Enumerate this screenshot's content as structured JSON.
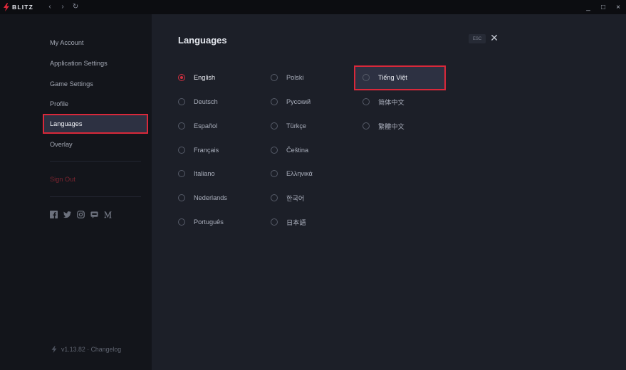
{
  "titlebar": {
    "app_name": "BLITZ",
    "back": "‹",
    "forward": "›",
    "refresh": "↻",
    "minimize": "_",
    "maximize": "□",
    "close": "×"
  },
  "sidebar": {
    "items": [
      {
        "label": "My Account"
      },
      {
        "label": "Application Settings"
      },
      {
        "label": "Game Settings"
      },
      {
        "label": "Profile"
      },
      {
        "label": "Languages",
        "active": true
      },
      {
        "label": "Overlay"
      }
    ],
    "sign_out": "Sign Out",
    "socials": [
      "facebook-icon",
      "twitter-icon",
      "instagram-icon",
      "discord-icon",
      "medium-icon"
    ],
    "version": "v1.13.82 · Changelog"
  },
  "main": {
    "title": "Languages",
    "esc_label": "ESC",
    "close_symbol": "✕",
    "selected_language": "English",
    "languages": {
      "col1": [
        "English",
        "Deutsch",
        "Español",
        "Français",
        "Italiano",
        "Nederlands",
        "Português"
      ],
      "col2": [
        "Polski",
        "Русский",
        "Türkçe",
        "Čeština",
        "Ελληνικά",
        "한국어",
        "日本語"
      ],
      "col3": [
        "Tiếng Việt",
        "简体中文",
        "繁體中文"
      ]
    }
  },
  "colors": {
    "accent": "#d9283a",
    "sidebar_bg": "#13151b",
    "main_bg": "#1c1f28",
    "active_bg": "#2d3142"
  }
}
